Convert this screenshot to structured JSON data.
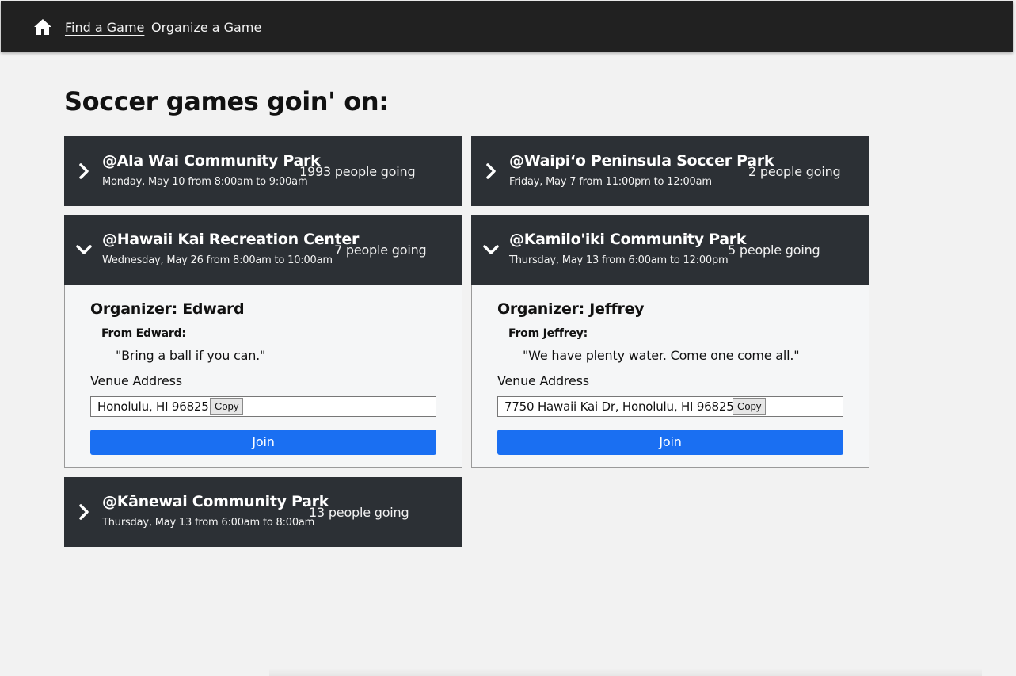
{
  "nav": {
    "home_icon": "home-icon",
    "links": [
      {
        "label": "Find a Game",
        "active": true
      },
      {
        "label": "Organize a Game",
        "active": false
      }
    ]
  },
  "page": {
    "title": "Soccer games goin' on:"
  },
  "colors": {
    "navbar": "#212121",
    "card_header": "#2c3035",
    "card_body": "#f5f6f7",
    "join_button": "#1a6ff2",
    "page_background": "#f2f2f2"
  },
  "games": [
    {
      "venue": "@Ala Wai Community Park",
      "time": "Monday, May 10 from 8:00am to 9:00am",
      "going": "1993 people going",
      "expanded": false,
      "chevron": "chevron-right-icon"
    },
    {
      "venue": "@Waipi‘o Peninsula Soccer Park",
      "time": "Friday, May 7 from 11:00pm to 12:00am",
      "going": "2 people going",
      "expanded": false,
      "chevron": "chevron-right-icon"
    },
    {
      "venue": "@Hawaii Kai Recreation Center",
      "time": "Wednesday, May 26 from 8:00am to 10:00am",
      "going": "7 people going",
      "expanded": true,
      "chevron": "chevron-down-icon",
      "organizer": "Organizer: Edward",
      "from_label": "From Edward:",
      "quote": "\"Bring a ball if you can.\"",
      "venue_label": "Venue Address",
      "address": "Honolulu, HI 96825",
      "copy_label": "Copy",
      "join_label": "Join"
    },
    {
      "venue": "@Kamilo'iki Community Park",
      "time": "Thursday, May 13 from 6:00am to 12:00pm",
      "going": "5 people going",
      "expanded": true,
      "chevron": "chevron-down-icon",
      "organizer": "Organizer: Jeffrey",
      "from_label": "From Jeffrey:",
      "quote": "\"We have plenty water. Come one come all.\"",
      "venue_label": "Venue Address",
      "address": "7750 Hawaii Kai Dr, Honolulu, HI 96825",
      "copy_label": "Copy",
      "join_label": "Join"
    },
    {
      "venue": "@Kānewai Community Park",
      "time": "Thursday, May 13 from 6:00am to 8:00am",
      "going": "13 people going",
      "expanded": false,
      "chevron": "chevron-right-icon"
    }
  ]
}
